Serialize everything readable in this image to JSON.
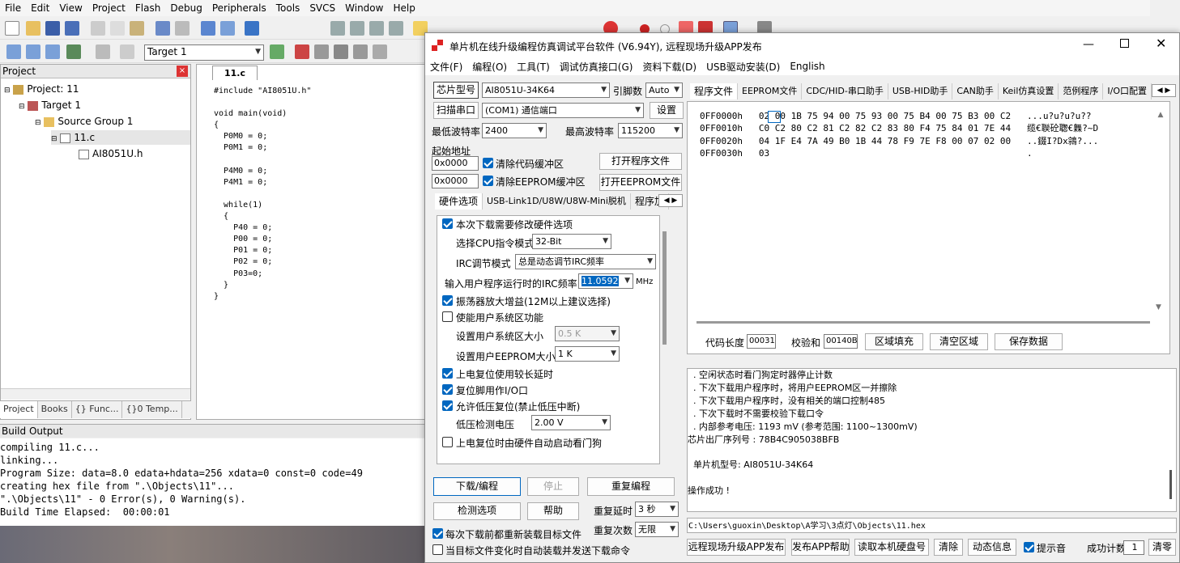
{
  "keil": {
    "menu": [
      "File",
      "Edit",
      "View",
      "Project",
      "Flash",
      "Debug",
      "Peripherals",
      "Tools",
      "SVCS",
      "Window",
      "Help"
    ],
    "target_select": "Target 1",
    "project_panel_title": "Project",
    "tree": [
      "Project: 11",
      "Target 1",
      "Source Group 1",
      "11.c",
      "AI8051U.h"
    ],
    "bottom_tabs": [
      "Project",
      "Books",
      "{} Func...",
      "{}0 Temp..."
    ],
    "editor_tab": "11.c",
    "code": "#include \"AI8051U.h\"\n\nvoid main(void)\n{\n  P0M0 = 0;\n  P0M1 = 0;\n\n  P4M0 = 0;\n  P4M1 = 0;\n\n  while(1)\n  {\n    P40 = 0;\n    P00 = 0;\n    P01 = 0;\n    P02 = 0;\n    P03=0;\n  }\n}",
    "build_title": "Build Output",
    "build_output": "compiling 11.c...\nlinking...\nProgram Size: data=8.0 edata+hdata=256 xdata=0 const=0 code=49\ncreating hex file from \".\\Objects\\11\"...\n\".\\Objects\\11\" - 0 Error(s), 0 Warning(s).\nBuild Time Elapsed:  00:00:01"
  },
  "stc": {
    "title": "单片机在线升级编程仿真调试平台软件 (V6.94Y), 远程现场升级APP发布",
    "menu": [
      "文件(F)",
      "编程(O)",
      "工具(T)",
      "调试仿真接口(G)",
      "资料下载(D)",
      "USB驱动安装(D)",
      "English"
    ],
    "chip_label": "芯片型号",
    "chip_value": "AI8051U-34K64",
    "pins_label": "引脚数",
    "pins_value": "Auto",
    "scan_port_button": "扫描串口",
    "port_value": "(COM1) 通信端口",
    "settings_button": "设置",
    "min_baud_label": "最低波特率",
    "min_baud_value": "2400",
    "max_baud_label": "最高波特率",
    "max_baud_value": "115200",
    "start_addr_label": "起始地址",
    "addr1": "0x0000",
    "addr2": "0x0000",
    "clear_code_buf": "清除代码缓冲区",
    "clear_eeprom_buf": "清除EEPROM缓冲区",
    "open_prog_button": "打开程序文件",
    "open_eeprom_button": "打开EEPROM文件",
    "left_tabs": [
      "硬件选项",
      "USB-Link1D/U8W/U8W-Mini脱机",
      "程序加"
    ],
    "opts": {
      "modify_hw": "本次下载需要修改硬件选项",
      "cpu_mode_label": "选择CPU指令模式",
      "cpu_mode_value": "32-Bit",
      "irc_mode_label": "IRC调节模式",
      "irc_mode_value": "总是动态调节IRC频率",
      "irc_freq_label": "输入用户程序运行时的IRC频率",
      "irc_freq_value": "11.0592",
      "irc_unit": "MHz",
      "osc_gain": "振荡器放大增益(12M以上建议选择)",
      "user_sys": "使能用户系统区功能",
      "user_sys_size_label": "设置用户系统区大小",
      "user_sys_size_value": "0.5 K",
      "eeprom_size_label": "设置用户EEPROM大小",
      "eeprom_size_value": "1   K",
      "long_delay": "上电复位使用较长延时",
      "reset_io": "复位脚用作I/O口",
      "lvr": "允许低压复位(禁止低压中断)",
      "lvd_label": "低压检测电压",
      "lvd_value": "2.00 V",
      "wdt": "上电复位时由硬件自动启动看门狗"
    },
    "download_button": "下载/编程",
    "stop_button": "停止",
    "reprogram_button": "重复编程",
    "check_button": "检测选项",
    "help_button": "帮助",
    "repeat_delay_label": "重复延时",
    "repeat_delay_value": "3 秒",
    "repeat_count_label": "重复次数",
    "repeat_count_value": "无限",
    "reload_each": "每次下载前都重新装载目标文件",
    "auto_send": "当目标文件变化时自动装载并发送下载命令",
    "right_tabs": [
      "程序文件",
      "EEPROM文件",
      "CDC/HID-串口助手",
      "USB-HID助手",
      "CAN助手",
      "Keil仿真设置",
      "范例程序",
      "I/O口配置"
    ],
    "hex": "0FF0000h   02 00 1B 75 94 00 75 93 00 75 B4 00 75 B3 00 C2   ...u?u?u?u??\n0FF0010h   C0 C2 80 C2 81 C2 82 C2 83 80 F4 75 84 01 7E 44   缆€聫砼聦€橆?~D\n0FF0020h   04 1F E4 7A 49 B0 1B 44 78 F9 7E F8 00 07 02 00   ..錣I?Dx鶎?...\n0FF0030h   03                                                .",
    "code_len_label": "代码长度",
    "code_len_value": "00031",
    "checksum_label": "校验和",
    "checksum_value": "00140B",
    "fill_button": "区域填充",
    "clear_area_button": "清空区域",
    "save_button": "保存数据",
    "log": "  . 空闲状态时看门狗定时器停止计数\n  . 下次下载用户程序时，将用户EEPROM区一并擦除\n  . 下次下载用户程序时，没有相关的端口控制485\n  . 下次下载时不需要校验下载口令\n  . 内部参考电压: 1193 mV (参考范围: 1100~1300mV)\n芯片出厂序列号 : 78B4C905038BFB\n\n  单片机型号: AI8051U-34K64\n\n操作成功 !",
    "path": "C:\\Users\\guoxin\\Desktop\\A学习\\3点灯\\Objects\\11.hex",
    "bottom_buttons": [
      "远程现场升级APP发布",
      "发布APP帮助",
      "读取本机硬盘号",
      "清除",
      "动态信息"
    ],
    "beep_label": "提示音",
    "success_label": "成功计数",
    "success_value": "1",
    "clear_count_button": "清零"
  },
  "colors": {
    "accent": "#0067c0",
    "stop_disabled": "#a0a0a0"
  }
}
